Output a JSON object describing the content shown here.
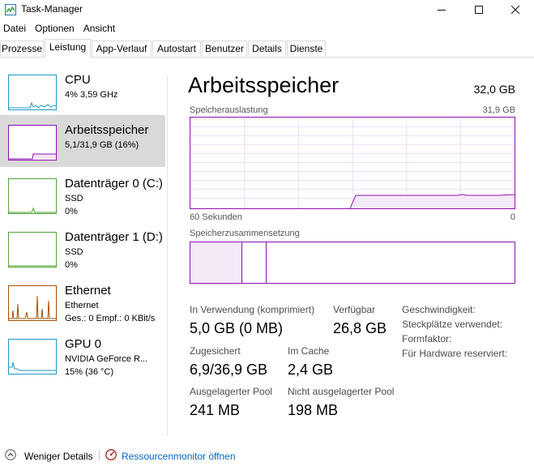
{
  "window": {
    "title": "Task-Manager"
  },
  "menu": [
    "Datei",
    "Optionen",
    "Ansicht"
  ],
  "tabs": [
    "Prozesse",
    "Leistung",
    "App-Verlauf",
    "Autostart",
    "Benutzer",
    "Details",
    "Dienste"
  ],
  "active_tab": "Leistung",
  "sidebar": {
    "items": [
      {
        "title": "CPU",
        "line1": "4% 3,59 GHz",
        "line2": "",
        "color": "#1a9ac8",
        "selected": false
      },
      {
        "title": "Arbeitsspeicher",
        "line1": "5,1/31,9 GB (16%)",
        "line2": "",
        "color": "#8b12ae",
        "selected": true
      },
      {
        "title": "Datenträger 0 (C:)",
        "line1": "SSD",
        "line2": "0%",
        "color": "#4da633",
        "selected": false
      },
      {
        "title": "Datenträger 1 (D:)",
        "line1": "SSD",
        "line2": "0%",
        "color": "#4da633",
        "selected": false
      },
      {
        "title": "Ethernet",
        "line1": "Ethernet",
        "line2": "Ges.: 0 Empf.: 0 KBit/s",
        "color": "#a74f01",
        "selected": false
      },
      {
        "title": "GPU 0",
        "line1": "NVIDIA GeForce R...",
        "line2": "15% (36 °C)",
        "color": "#1a9ac8",
        "selected": false
      }
    ]
  },
  "main": {
    "title": "Arbeitsspeicher",
    "total": "32,0 GB",
    "usage_label": "Speicherauslastung",
    "usage_max": "31,9 GB",
    "time_label": "60 Sekunden",
    "time_end": "0",
    "composition_label": "Speicherzusammensetzung",
    "accent_color": "#8b12ae"
  },
  "stats": {
    "in_use_label": "In Verwendung (komprimiert)",
    "in_use_value": "5,0 GB (0 MB)",
    "available_label": "Verfügbar",
    "available_value": "26,8 GB",
    "committed_label": "Zugesichert",
    "committed_value": "6,9/36,9 GB",
    "cached_label": "Im Cache",
    "cached_value": "2,4 GB",
    "paged_label": "Ausgelagerter Pool",
    "paged_value": "241 MB",
    "nonpaged_label": "Nicht ausgelagerter Pool",
    "nonpaged_value": "198 MB"
  },
  "properties": [
    "Geschwindigkeit:",
    "Steckplätze verwendet:",
    "Formfaktor:",
    "Für Hardware reserviert:"
  ],
  "footer": {
    "fewer_details": "Weniger Details",
    "resource_monitor": "Ressourcenmonitor öffnen"
  }
}
